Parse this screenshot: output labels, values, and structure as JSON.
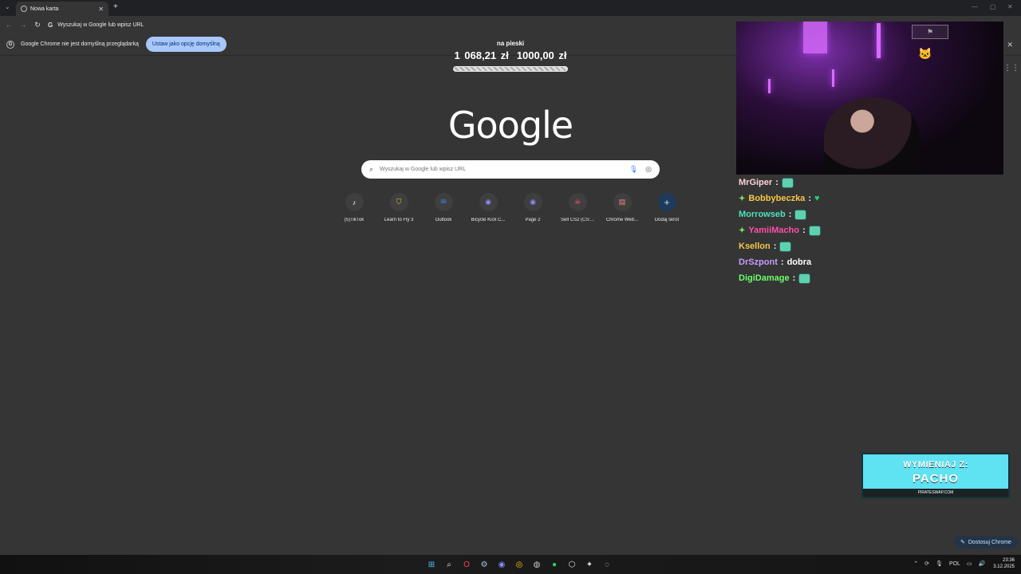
{
  "browser": {
    "tab_title": "Nowa karta",
    "omnibox_text": "Wyszukaj w Google lub wpisz URL",
    "infobar_text": "Google Chrome nie jest domyślną przeglądarką",
    "infobar_button": "Ustaw jako opcję domyślną"
  },
  "goal_widget": {
    "title": "na pieski",
    "current": "1 068,21 zł",
    "target": "1000,00 zł",
    "progress_fraction": 1.0
  },
  "newtab": {
    "logo": "Google",
    "search_placeholder": "Wyszukaj w Google lub wpisz URL",
    "shortcuts": [
      {
        "label": "(5)TikTok",
        "icon": "tiktok-icon"
      },
      {
        "label": "Learn to Fly 3",
        "icon": "shield-icon"
      },
      {
        "label": "Outlook",
        "icon": "outlook-icon"
      },
      {
        "label": "Bicycle Kick C...",
        "icon": "discord-icon"
      },
      {
        "label": "Page 2",
        "icon": "discord-icon"
      },
      {
        "label": "Sell CS2 (CS:...",
        "icon": "pirate-icon"
      },
      {
        "label": "Chrome Web...",
        "icon": "store-icon"
      },
      {
        "label": "Dodaj skrót",
        "icon": "plus-icon"
      }
    ],
    "customize_label": "Dostosuj Chrome"
  },
  "chat": [
    {
      "user": "MrGiper",
      "color": "#ffd1dc",
      "badge": false,
      "content": "emote"
    },
    {
      "user": "Bobbybeczka",
      "color": "#f6c945",
      "badge": true,
      "content": "heart"
    },
    {
      "user": "Morrowseb",
      "color": "#4fe0c0",
      "badge": false,
      "content": "emote"
    },
    {
      "user": "YamiiMacho",
      "color": "#ff4fa8",
      "badge": true,
      "content": "emote"
    },
    {
      "user": "Ksellon",
      "color": "#f6c945",
      "badge": false,
      "content": "emote"
    },
    {
      "user": "DrSzpont",
      "color": "#c99bff",
      "badge": false,
      "content": "text",
      "text": "dobra"
    },
    {
      "user": "DigiDamage",
      "color": "#6bff6b",
      "badge": false,
      "content": "emote"
    }
  ],
  "ad": {
    "line1": "WYMIENIAJ Z:",
    "line2": "PACHO",
    "footer": "PIRATESWAP.COM"
  },
  "taskbar": {
    "language": "POL",
    "time": "23:36",
    "date": "3.12.2025"
  }
}
